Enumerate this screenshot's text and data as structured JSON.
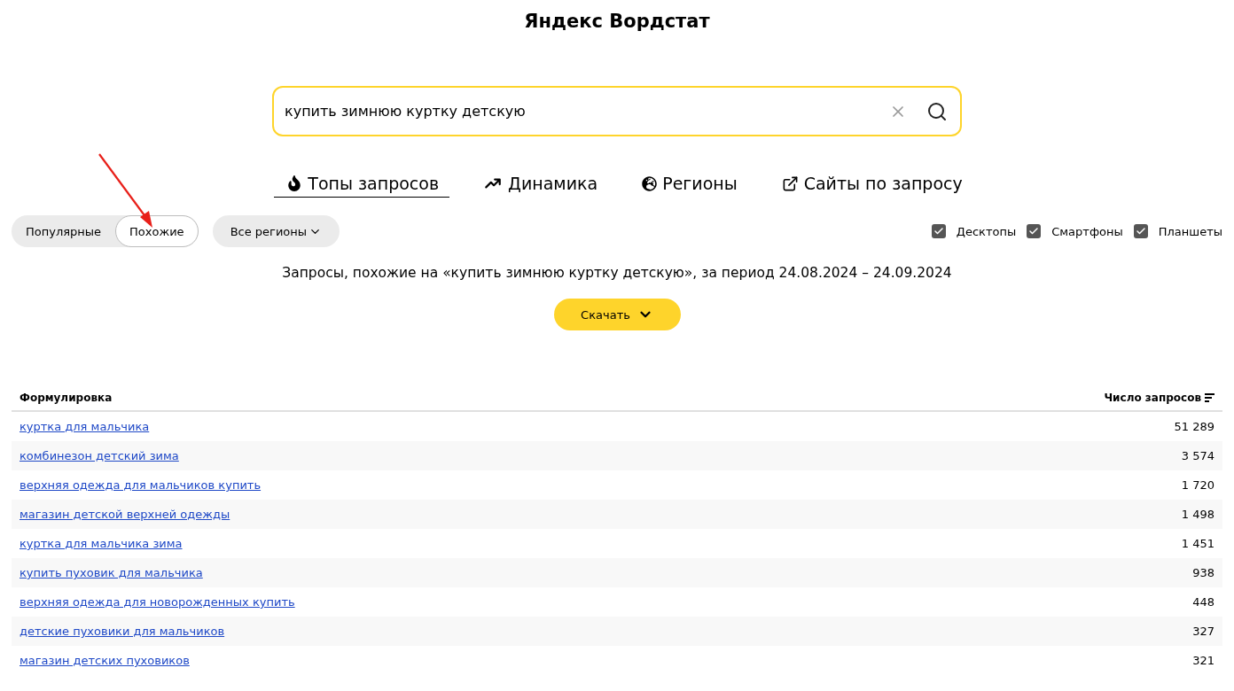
{
  "title": "Яндекс Вордстат",
  "search": {
    "value": "купить зимнюю куртку детскую"
  },
  "tabs": [
    {
      "label": "Топы запросов",
      "kind": "fire",
      "selected": true
    },
    {
      "label": "Динамика",
      "kind": "trend",
      "selected": false
    },
    {
      "label": "Регионы",
      "kind": "globe",
      "selected": false
    },
    {
      "label": "Сайты по запросу",
      "kind": "external",
      "selected": false
    }
  ],
  "mode_switch": [
    {
      "label": "Популярные",
      "selected": false
    },
    {
      "label": "Похожие",
      "selected": true
    }
  ],
  "region_select": {
    "label": "Все регионы"
  },
  "devices": [
    {
      "label": "Десктопы",
      "checked": true
    },
    {
      "label": "Смартфоны",
      "checked": true
    },
    {
      "label": "Планшеты",
      "checked": true
    }
  ],
  "summary": "Запросы, похожие на «купить зимнюю куртку детскую», за период 24.08.2024 – 24.09.2024",
  "download_button": {
    "label": "Скачать"
  },
  "table": {
    "columns": [
      "Формулировка",
      "Число запросов"
    ],
    "rows": [
      {
        "phrase": "куртка для мальчика",
        "count": "51 289"
      },
      {
        "phrase": "комбинезон детский зима",
        "count": "3 574"
      },
      {
        "phrase": "верхняя одежда для мальчиков купить",
        "count": "1 720"
      },
      {
        "phrase": "магазин детской верхней одежды",
        "count": "1 498"
      },
      {
        "phrase": "куртка для мальчика зима",
        "count": "1 451"
      },
      {
        "phrase": "купить пуховик для мальчика",
        "count": "938"
      },
      {
        "phrase": "верхняя одежда для новорожденных купить",
        "count": "448"
      },
      {
        "phrase": "детские пуховики для мальчиков",
        "count": "327"
      },
      {
        "phrase": "магазин детских пуховиков",
        "count": "321"
      }
    ]
  }
}
